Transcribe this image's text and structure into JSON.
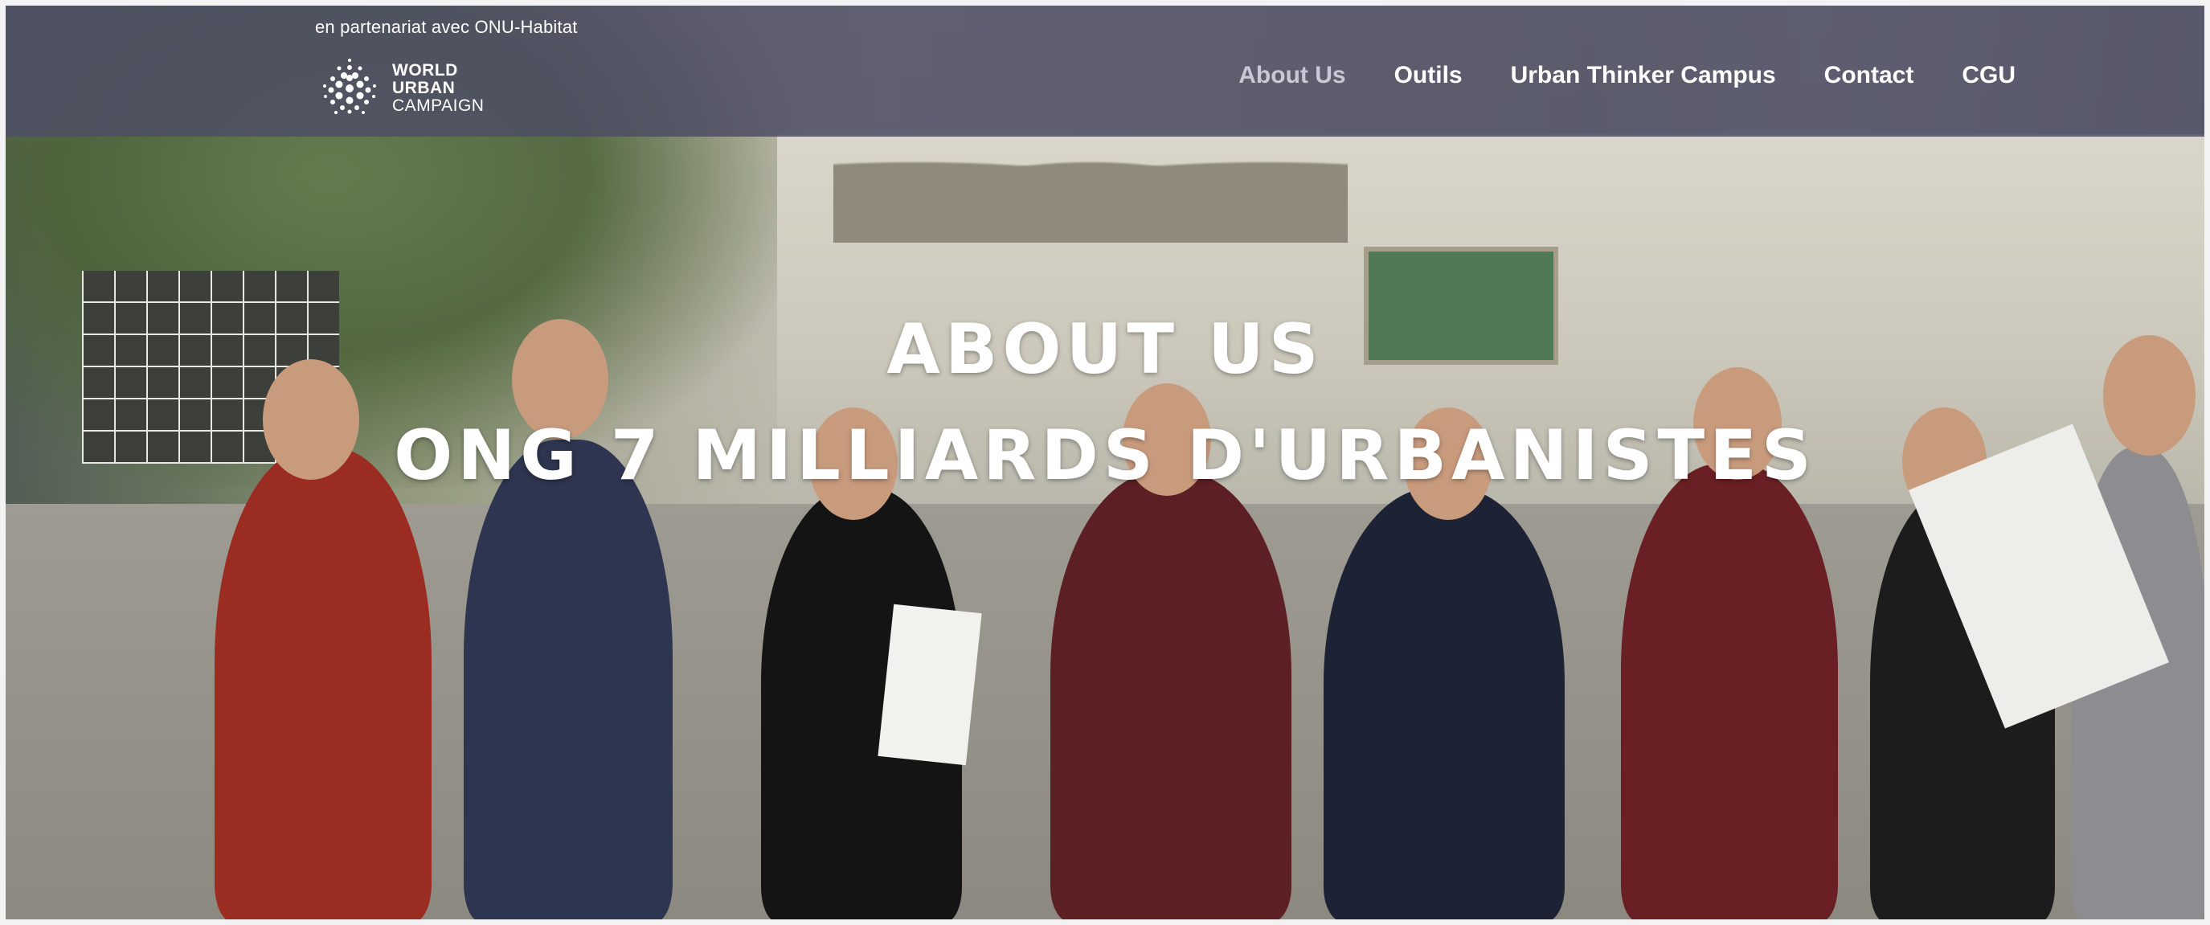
{
  "header": {
    "partner_text": "en partenariat avec ONU-Habitat",
    "logo": {
      "line1": "WORLD",
      "line2": "URBAN",
      "line3": "CAMPAIGN",
      "icon": "dotted-globe-icon"
    }
  },
  "nav": {
    "items": [
      {
        "label": "About Us",
        "active": true
      },
      {
        "label": "Outils",
        "active": false
      },
      {
        "label": "Urban Thinker Campus",
        "active": false
      },
      {
        "label": "Contact",
        "active": false
      },
      {
        "label": "CGU",
        "active": false
      }
    ]
  },
  "hero": {
    "title": "ABOUT US",
    "subtitle": "ONG 7 MILLIARDS D'URBANISTES"
  },
  "colors": {
    "navbar_bg": "#4e4e64",
    "nav_text": "#ffffff",
    "nav_active": "#c9c9d3",
    "title_text": "#ffffff"
  }
}
